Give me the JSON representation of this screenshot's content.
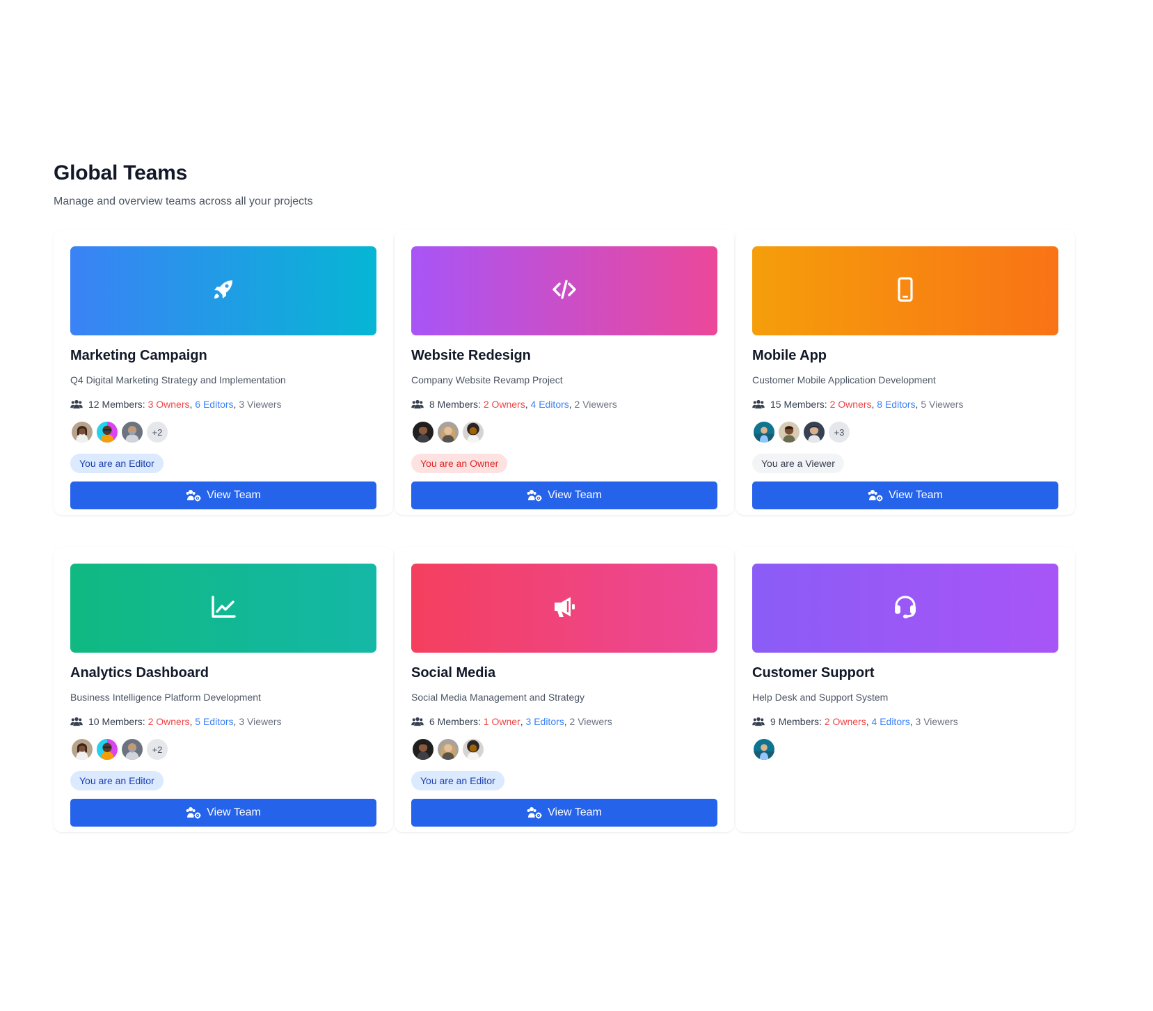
{
  "header": {
    "title": "Global Teams",
    "subtitle": "Manage and overview teams across all your projects"
  },
  "teams": [
    {
      "name": "Marketing Campaign",
      "description": "Q4 Digital Marketing Strategy and Implementation",
      "icon": "rocket-icon",
      "gradient": [
        "#3b82f6",
        "#06b6d4"
      ],
      "members_prefix": "12 Members:",
      "owners": "3 Owners",
      "editors": "6 Editors",
      "viewers": "3 Viewers",
      "more": "+2",
      "role": "You are an Editor",
      "role_type": "editor",
      "button": "View Team"
    },
    {
      "name": "Website Redesign",
      "description": "Company Website Revamp Project",
      "icon": "code-icon",
      "gradient": [
        "#a855f7",
        "#ec4899"
      ],
      "members_prefix": "8 Members:",
      "owners": "2 Owners",
      "editors": "4 Editors",
      "viewers": "2 Viewers",
      "more": "",
      "role": "You are an Owner",
      "role_type": "owner",
      "button": "View Team"
    },
    {
      "name": "Mobile App",
      "description": "Customer Mobile Application Development",
      "icon": "mobile-icon",
      "gradient": [
        "#f59e0b",
        "#f97316"
      ],
      "members_prefix": "15 Members:",
      "owners": "2 Owners",
      "editors": "8 Editors",
      "viewers": "5 Viewers",
      "more": "+3",
      "role": "You are a Viewer",
      "role_type": "viewer",
      "button": "View Team"
    },
    {
      "name": "Analytics Dashboard",
      "description": "Business Intelligence Platform Development",
      "icon": "chart-line-icon",
      "gradient": [
        "#10b981",
        "#14b8a6"
      ],
      "members_prefix": "10 Members:",
      "owners": "2 Owners",
      "editors": "5 Editors",
      "viewers": "3 Viewers",
      "more": "+2",
      "role": "You are an Editor",
      "role_type": "editor",
      "button": "View Team"
    },
    {
      "name": "Social Media",
      "description": "Social Media Management and Strategy",
      "icon": "megaphone-icon",
      "gradient": [
        "#f43f5e",
        "#ec4899"
      ],
      "members_prefix": "6 Members:",
      "owners": "1 Owner",
      "editors": "3 Editors",
      "viewers": "2 Viewers",
      "more": "",
      "role": "You are an Editor",
      "role_type": "editor",
      "button": "View Team"
    },
    {
      "name": "Customer Support",
      "description": "Help Desk and Support System",
      "icon": "headset-icon",
      "gradient": [
        "#8b5cf6",
        "#a855f7"
      ],
      "members_prefix": "9 Members:",
      "owners": "2 Owners",
      "editors": "4 Editors",
      "viewers": "3 Viewers",
      "more": "",
      "role": "",
      "role_type": "",
      "button": ""
    }
  ]
}
